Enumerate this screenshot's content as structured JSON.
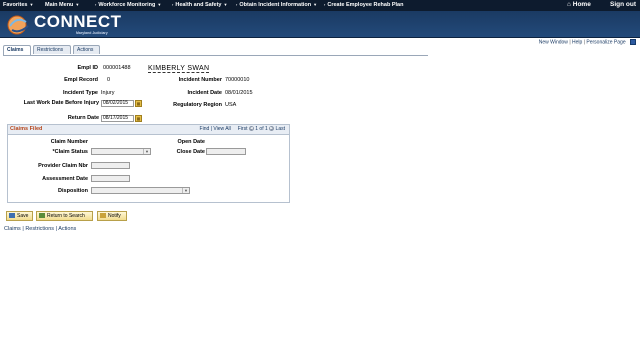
{
  "top_nav": {
    "favorites": "Favorites",
    "main_menu": "Main Menu",
    "workforce_monitoring": "Workforce Monitoring",
    "health_safety": "Health and Safety",
    "obtain_incident": "Obtain Incident Information",
    "create_rehab": "Create Employee Rehab Plan",
    "home": "Home",
    "sign_out": "Sign out"
  },
  "banner": {
    "logo_text": "CONNECT",
    "logo_subtitle": "Maryland Judiciary"
  },
  "tabs": [
    {
      "label": "Claims",
      "active": true
    },
    {
      "label": "Restrictions",
      "active": false
    },
    {
      "label": "Actions",
      "active": false
    }
  ],
  "top_links": {
    "new_window": "New Window",
    "help": "Help",
    "personalize": "Personalize Page"
  },
  "header_fields": {
    "empl_id_label": "Empl ID",
    "empl_id": "000001488",
    "employee_name": "KIMBERLY SWAN",
    "empl_record_label": "Empl Record",
    "empl_record": "0",
    "incident_number_label": "Incident Number",
    "incident_number": "70000010",
    "incident_type_label": "Incident Type",
    "incident_type": "Injury",
    "incident_date_label": "Incident Date",
    "incident_date": "08/01/2015",
    "last_work_date_label": "Last Work Date Before Injury",
    "last_work_date": "08/02/2015",
    "regulatory_region_label": "Regulatory Region",
    "regulatory_region": "USA",
    "return_date_label": "Return Date",
    "return_date": "08/17/2015"
  },
  "claims_box": {
    "title": "Claims Filed",
    "find": "Find",
    "view_all": "View All",
    "first": "First",
    "count": "1 of 1",
    "last": "Last",
    "claim_number_label": "Claim Number",
    "open_date_label": "Open Date",
    "claim_status_label": "*Claim Status",
    "close_date_label": "Close Date",
    "provider_claim_label": "Provider Claim Nbr",
    "assessment_date_label": "Assessment Date",
    "disposition_label": "Disposition"
  },
  "buttons": {
    "save": "Save",
    "return_to_search": "Return to Search",
    "notify": "Notify"
  },
  "bottom_links": {
    "claims": "Claims",
    "restrictions": "Restrictions",
    "actions": "Actions"
  },
  "colors": {
    "nav_bg": "#0d1b2e",
    "banner_bg": "#1a3a63",
    "section_title": "#b5451b",
    "link": "#1a3a63"
  }
}
